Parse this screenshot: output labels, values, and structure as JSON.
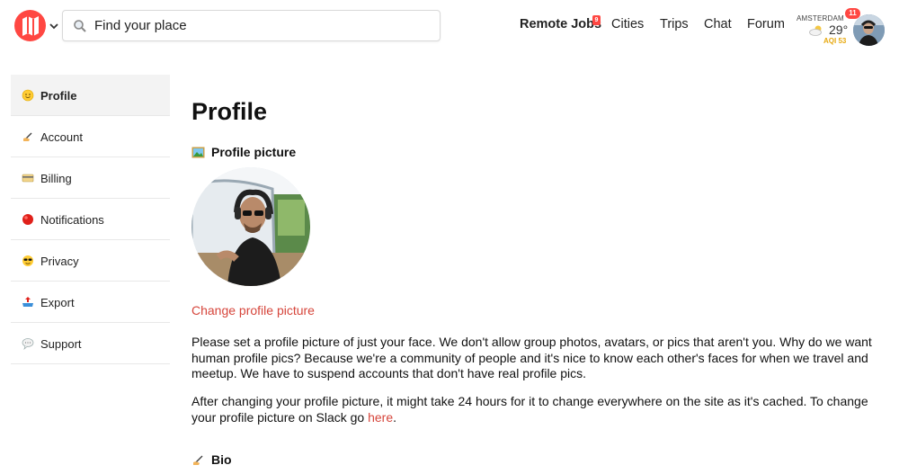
{
  "header": {
    "search_placeholder": "Find your place",
    "nav": {
      "remote_jobs": "Remote Jobs",
      "remote_jobs_badge": "9",
      "cities": "Cities",
      "trips": "Trips",
      "chat": "Chat",
      "forum": "Forum"
    },
    "weather": {
      "city": "AMSTERDAM",
      "temp": "29°",
      "aqi": "AQI 53",
      "icon": "partly-cloudy-icon"
    },
    "notification_count": "11"
  },
  "sidebar": {
    "items": [
      {
        "label": "Profile",
        "icon": "smile-emoji",
        "active": true
      },
      {
        "label": "Account",
        "icon": "writing-hand-emoji"
      },
      {
        "label": "Billing",
        "icon": "credit-card-emoji"
      },
      {
        "label": "Notifications",
        "icon": "red-circle-emoji"
      },
      {
        "label": "Privacy",
        "icon": "sunglasses-emoji"
      },
      {
        "label": "Export",
        "icon": "outbox-tray-emoji"
      },
      {
        "label": "Support",
        "icon": "speech-balloon-emoji"
      }
    ]
  },
  "main": {
    "title": "Profile",
    "profile_picture_heading": "Profile picture",
    "change_picture_link": "Change profile picture",
    "paragraph_1": "Please set a profile picture of just your face. We don't allow group photos, avatars, or pics that aren't you. Why do we want human profile pics? Because we're a community of people and it's nice to know each other's faces for when we travel and meetup. We have to suspend accounts that don't have real profile pics.",
    "paragraph_2_text": "After changing your profile picture, it might take 24 hours for it to change everywhere on the site as it's cached. To change your profile picture on Slack go ",
    "paragraph_2_link": "here",
    "paragraph_2_end": ".",
    "bio_heading": "Bio"
  },
  "colors": {
    "brand": "#ff4742",
    "link": "#d6453b",
    "aqi": "#e7a90f"
  }
}
